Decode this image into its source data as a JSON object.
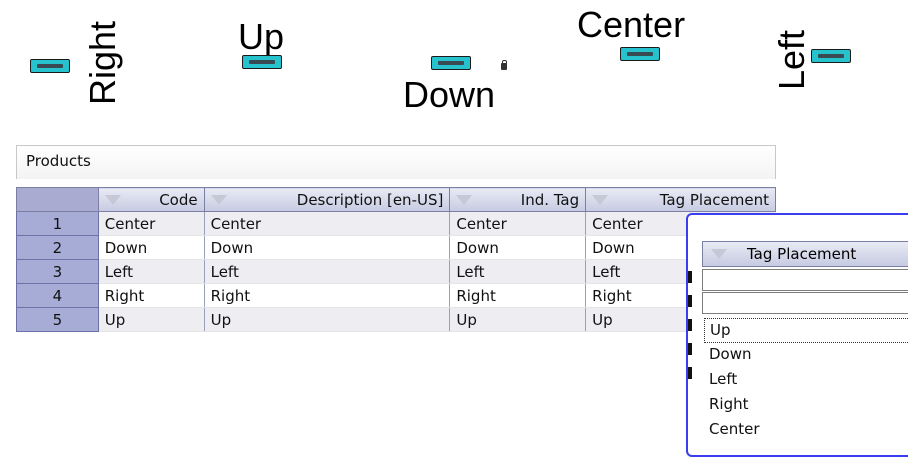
{
  "tag_demo": {
    "labels": {
      "right": "Right",
      "up": "Up",
      "down": "Down",
      "center": "Center",
      "left": "Left"
    },
    "tag_color": "#26c3cf"
  },
  "products": {
    "title": "Products",
    "columns": [
      "Code",
      "Description [en-US]",
      "Ind. Tag",
      "Tag Placement"
    ],
    "rows": [
      {
        "num": "1",
        "code": "Center",
        "description": "Center",
        "ind_tag": "Center",
        "placement": "Center"
      },
      {
        "num": "2",
        "code": "Down",
        "description": "Down",
        "ind_tag": "Down",
        "placement": "Down"
      },
      {
        "num": "3",
        "code": "Left",
        "description": "Left",
        "ind_tag": "Left",
        "placement": "Left"
      },
      {
        "num": "4",
        "code": "Right",
        "description": "Right",
        "ind_tag": "Right",
        "placement": "Right"
      },
      {
        "num": "5",
        "code": "Up",
        "description": "Up",
        "ind_tag": "Up",
        "placement": "Up"
      }
    ]
  },
  "popup": {
    "header": "Tag Placement",
    "options": [
      "Up",
      "Down",
      "Left",
      "Right",
      "Center"
    ],
    "selected": "Up",
    "border_color": "#3a3ef0"
  }
}
